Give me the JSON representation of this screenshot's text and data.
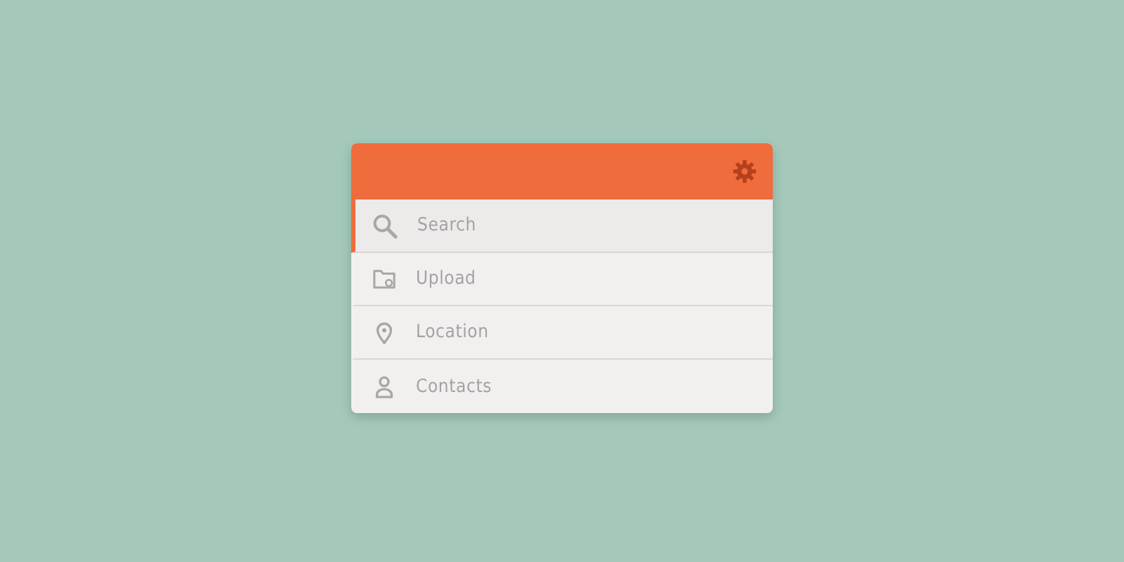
{
  "menu": {
    "items": [
      {
        "label": "Search",
        "kind": "search",
        "selected": true
      },
      {
        "label": "Upload",
        "kind": "upload",
        "selected": false
      },
      {
        "label": "Location",
        "kind": "location",
        "selected": false
      },
      {
        "label": "Contacts",
        "kind": "contacts",
        "selected": false
      }
    ]
  }
}
